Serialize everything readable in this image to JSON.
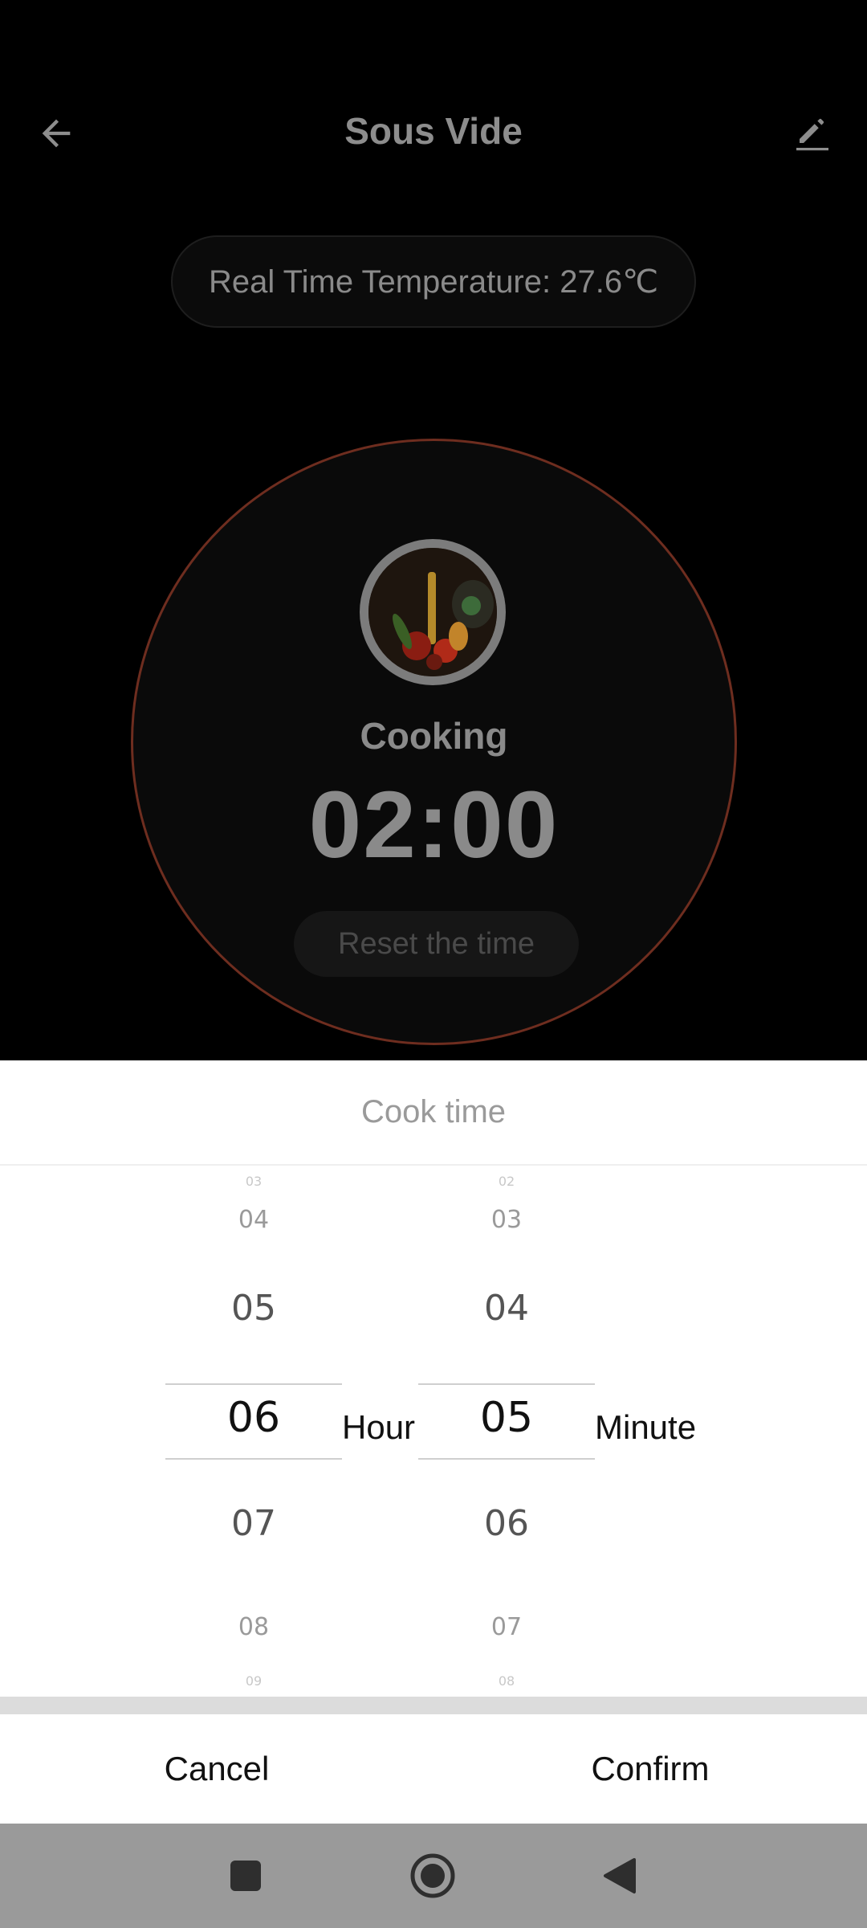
{
  "header": {
    "title": "Sous Vide",
    "back_icon": "arrow-left-icon",
    "edit_icon": "pencil-icon"
  },
  "temperature": {
    "label": "Real Time Temperature: 27.6℃"
  },
  "dial": {
    "status": "Cooking",
    "time": "02:00",
    "reset_label": "Reset the time",
    "ring_color": "#6e2d1f"
  },
  "sheet": {
    "title": "Cook time",
    "hours": {
      "items": [
        "03",
        "04",
        "05",
        "06",
        "07",
        "08",
        "09"
      ],
      "selected": "06",
      "unit": "Hour"
    },
    "minutes": {
      "items": [
        "02",
        "03",
        "04",
        "05",
        "06",
        "07",
        "08"
      ],
      "selected": "05",
      "unit": "Minute"
    },
    "cancel_label": "Cancel",
    "confirm_label": "Confirm"
  },
  "system_nav": {
    "recents_icon": "square-icon",
    "home_icon": "circle-home-icon",
    "back_icon": "triangle-back-icon"
  }
}
